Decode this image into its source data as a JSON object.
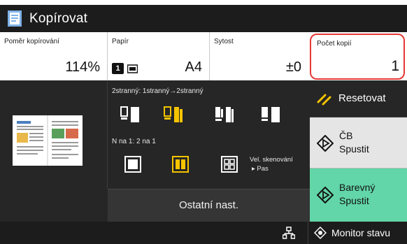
{
  "title": "Kopírovat",
  "settings": {
    "ratio": {
      "label": "Poměr kopírování",
      "value": "114%"
    },
    "paper": {
      "label": "Papír",
      "tray": "1",
      "size": "A4"
    },
    "density": {
      "label": "Sytost",
      "value": "±0"
    },
    "copies": {
      "label": "Počet kopií",
      "value": "1"
    }
  },
  "duplex": {
    "label": "2stranný: 1stranný→2stranný",
    "options": [
      "duplex-1to1-icon",
      "duplex-1to2-icon",
      "duplex-2to1-icon",
      "duplex-2to2-icon"
    ],
    "selected_index": 1
  },
  "nup": {
    "label": "N na 1: 2 na 1",
    "options": [
      "nup-off-icon",
      "nup-2on1-icon",
      "nup-4on1-icon"
    ],
    "selected_index": 1
  },
  "scan_size": {
    "line1": "Vel. skenování",
    "line2": "▸ Pas"
  },
  "other_settings_label": "Ostatní nast.",
  "buttons": {
    "reset": "Resetovat",
    "bw_start_line1": "ČB",
    "bw_start_line2": "Spustit",
    "color_start_line1": "Barevný",
    "color_start_line2": "Spustit"
  },
  "status_monitor_label": "Monitor stavu",
  "colors": {
    "accent_yellow": "#f5c400",
    "color_start_bg": "#62d6a8",
    "bw_start_bg": "#e5e5e5",
    "highlight_border": "#e53935",
    "dark_bg": "#262626"
  }
}
